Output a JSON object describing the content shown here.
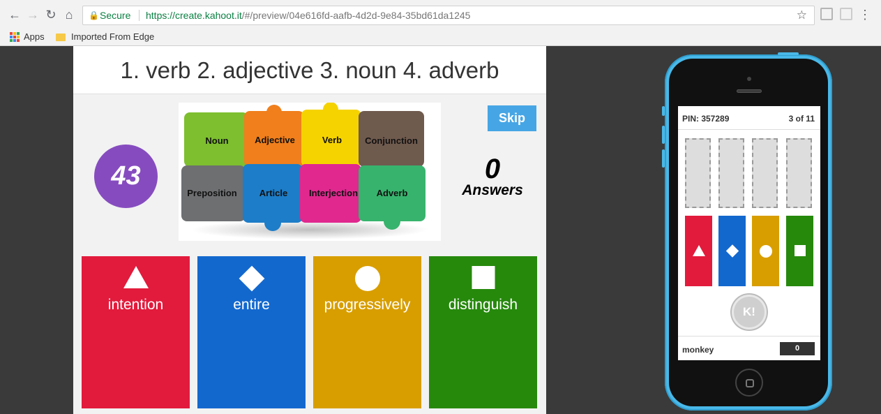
{
  "browser": {
    "secure_label": "Secure",
    "url_host": "https://create.kahoot.it",
    "url_rest": "/#/preview/04e616fd-aafb-4d2d-9e84-35bd61da1245",
    "bookmarks": [
      "Apps",
      "Imported From Edge"
    ]
  },
  "game": {
    "question": "1. verb 2. adjective 3. noun 4. adverb",
    "timer": "43",
    "skip_label": "Skip",
    "answers_count": "0",
    "answers_label": "Answers",
    "image_words": [
      "Noun",
      "Adjective",
      "Verb",
      "Conjunction",
      "Preposition",
      "Article",
      "Interjection",
      "Adverb"
    ],
    "choices": [
      {
        "label": "intention",
        "shape": "triangle",
        "color": "#e21b3c"
      },
      {
        "label": "entire",
        "shape": "diamond",
        "color": "#1368ce"
      },
      {
        "label": "progressively",
        "shape": "circle",
        "color": "#d89e00"
      },
      {
        "label": "distinguish",
        "shape": "square",
        "color": "#26890c"
      }
    ]
  },
  "phone": {
    "pin": "PIN: 357289",
    "progress": "3 of 11",
    "badge": "K!",
    "nickname": "monkey",
    "score": "0"
  }
}
